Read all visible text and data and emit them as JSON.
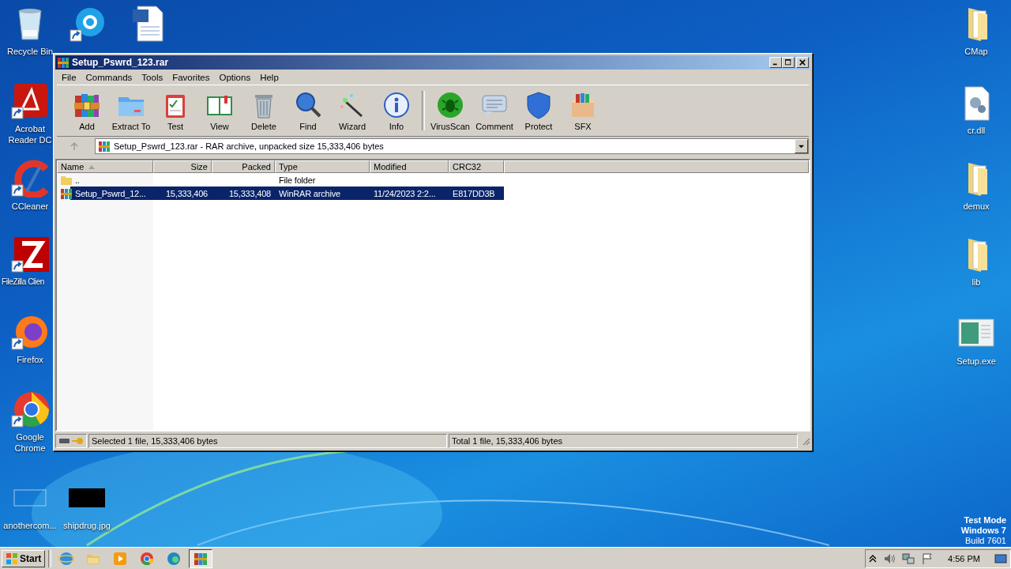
{
  "desktop": {
    "left_icons": [
      {
        "label": "Recycle Bin",
        "kind": "recycle",
        "shortcut": false
      },
      {
        "kind": "skype",
        "shortcut": true
      },
      {
        "kind": "word",
        "shortcut": false
      },
      {
        "label": "Acrobat Reader DC",
        "kind": "pdf",
        "shortcut": true
      },
      {
        "label": "CCleaner",
        "kind": "ccleaner",
        "shortcut": true
      },
      {
        "label": "FileZilla Clien",
        "kind": "filezilla",
        "shortcut": true
      },
      {
        "label": "Firefox",
        "kind": "firefox",
        "shortcut": true
      },
      {
        "label": "Google Chrome",
        "kind": "chrome",
        "shortcut": true
      },
      {
        "label": "anothercom...",
        "kind": "blank",
        "shortcut": false
      },
      {
        "label": "shipdrug.jpg",
        "kind": "black",
        "shortcut": false
      }
    ],
    "right_icons": [
      {
        "label": "CMap",
        "kind": "folder",
        "shortcut": false
      },
      {
        "label": "cr.dll",
        "kind": "dll",
        "shortcut": false
      },
      {
        "label": "demux",
        "kind": "folder",
        "shortcut": false
      },
      {
        "label": "lib",
        "kind": "folder",
        "shortcut": false
      },
      {
        "label": "Setup.exe",
        "kind": "exe",
        "shortcut": false
      }
    ],
    "watermark": [
      "Test Mode",
      "Windows 7",
      "Build 7601"
    ]
  },
  "window": {
    "title": "Setup_Pswrd_123.rar",
    "menu": [
      "File",
      "Commands",
      "Tools",
      "Favorites",
      "Options",
      "Help"
    ],
    "toolbar": [
      {
        "label": "Add",
        "kind": "add"
      },
      {
        "label": "Extract To",
        "kind": "extract"
      },
      {
        "label": "Test",
        "kind": "test"
      },
      {
        "label": "View",
        "kind": "view"
      },
      {
        "label": "Delete",
        "kind": "delete"
      },
      {
        "label": "Find",
        "kind": "find"
      },
      {
        "label": "Wizard",
        "kind": "wizard"
      },
      {
        "label": "Info",
        "kind": "info"
      },
      {
        "label": "VirusScan",
        "kind": "virus"
      },
      {
        "label": "Comment",
        "kind": "comment"
      },
      {
        "label": "Protect",
        "kind": "protect"
      },
      {
        "label": "SFX",
        "kind": "sfx"
      }
    ],
    "address": "Setup_Pswrd_123.rar - RAR archive, unpacked size 15,333,406 bytes",
    "columns": [
      {
        "label": "Name",
        "sorted": true
      },
      {
        "label": "Size",
        "sorted": false
      },
      {
        "label": "Packed",
        "sorted": false
      },
      {
        "label": "Type",
        "sorted": false
      },
      {
        "label": "Modified",
        "sorted": false
      },
      {
        "label": "CRC32",
        "sorted": false
      }
    ],
    "rows": [
      {
        "kind": "folder",
        "selected": false,
        "cells": [
          "..",
          "",
          "",
          "File folder",
          "",
          ""
        ]
      },
      {
        "kind": "rar",
        "selected": true,
        "cells": [
          "Setup_Pswrd_12...",
          "15,333,406",
          "15,333,408",
          "WinRAR archive",
          "11/24/2023 2:2...",
          "E817DD3B"
        ]
      }
    ],
    "status_left": "Selected 1 file, 15,333,406 bytes",
    "status_right": "Total 1 file, 15,333,406 bytes"
  },
  "taskbar": {
    "start": "Start",
    "apps": [
      {
        "kind": "ie",
        "selected": false
      },
      {
        "kind": "explorer",
        "selected": false
      },
      {
        "kind": "media",
        "selected": false
      },
      {
        "kind": "chrome",
        "selected": false
      },
      {
        "kind": "edge",
        "selected": false
      },
      {
        "kind": "winrar",
        "selected": true
      }
    ],
    "clock": "4:56 PM"
  }
}
